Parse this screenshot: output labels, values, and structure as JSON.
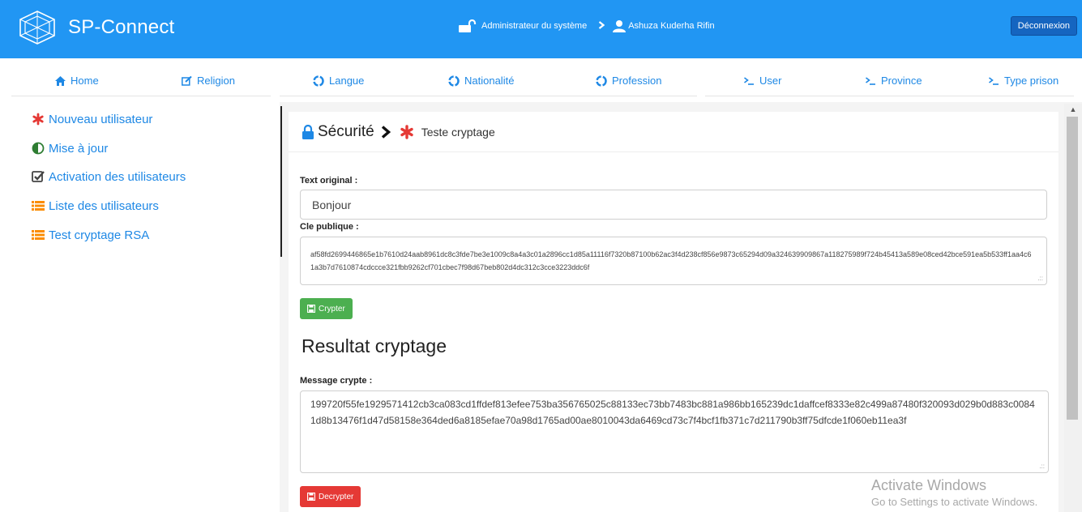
{
  "header": {
    "brand": "SP-Connect",
    "role": "Administrateur du système",
    "user": "Ashuza Kuderha Rifin",
    "logout_label": "Déconnexion",
    "bg_color": "#2196f3"
  },
  "nav": {
    "items": [
      {
        "label": "Home",
        "icon": "home-icon"
      },
      {
        "label": "Religion",
        "icon": "edit-icon"
      },
      {
        "label": "Langue",
        "icon": "recycle-icon"
      },
      {
        "label": "Nationalité",
        "icon": "recycle-icon"
      },
      {
        "label": "Profession",
        "icon": "recycle-icon"
      },
      {
        "label": "User",
        "icon": "terminal-icon"
      },
      {
        "label": "Province",
        "icon": "terminal-icon"
      },
      {
        "label": "Type prison",
        "icon": "terminal-icon"
      }
    ]
  },
  "sidebar": {
    "items": [
      {
        "label": "Nouveau utilisateur",
        "icon": "asterisk-icon"
      },
      {
        "label": "Mise à jour",
        "icon": "half-circle-icon"
      },
      {
        "label": "Activation des utilisateurs",
        "icon": "check-square-icon"
      },
      {
        "label": "Liste des utilisateurs",
        "icon": "list-icon"
      },
      {
        "label": "Test cryptage RSA",
        "icon": "list-icon"
      }
    ]
  },
  "panel": {
    "title": "Sécurité",
    "subtitle": "Teste cryptage",
    "original_label": "Text original :",
    "original_value": "Bonjour",
    "key_label": "Cle publique :",
    "key_value": "af58fd2699446865e1b7610d24aab8961dc8c3fde7be3e1009c8a4a3c01a2896cc1d85a11116f7320b87100b62ac3f4d238cf856e9873c65294d09a324639909867a118275989f724b45413a589e08ced42bce591ea5b533ff1aa4c61a3b7d7610874cdccce321fbb9262cf701cbec7f98d67beb802d4dc312c3cce3223ddc6f",
    "encrypt_label": "Crypter",
    "result_title": "Resultat cryptage",
    "message_label": "Message crypte :",
    "message_value": "199720f55fe1929571412cb3ca083cd1ffdef813efee753ba356765025c88133ec73bb7483bc881a986bb165239dc1daffcef8333e82c499a87480f320093d029b0d883c00841d8b13476f1d47d58158e364ded6a8185efae70a98d1765ad00ae8010043da6469cd73c7f4bcf1fb371c7d211790b3ff75dfcde1f060eb11ea3f",
    "decrypt_label": "Decrypter",
    "success_color": "#4caf50",
    "danger_color": "#e53935"
  },
  "watermark": {
    "line1": "Activate Windows",
    "line2": "Go to Settings to activate Windows."
  }
}
